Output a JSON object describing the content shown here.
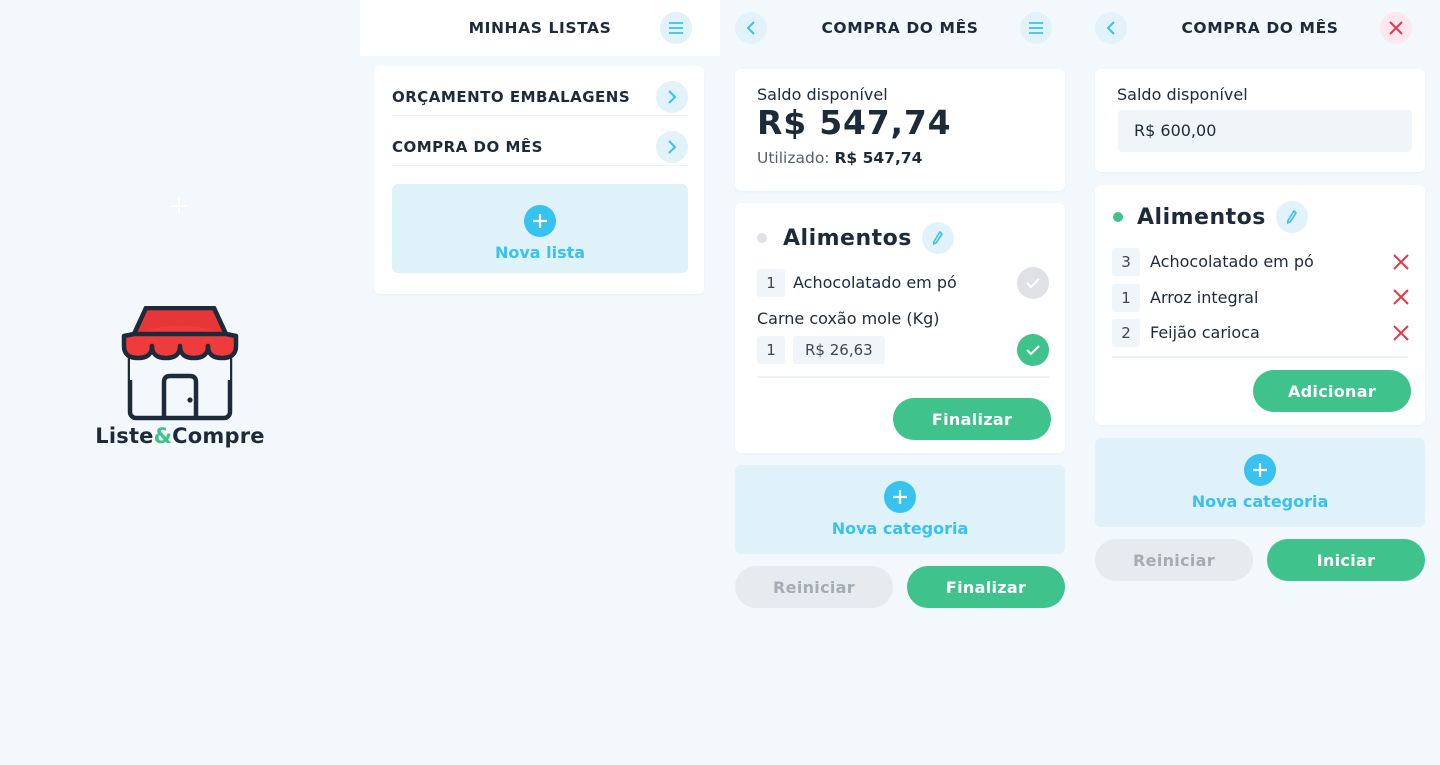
{
  "splash": {
    "brand_part1": "Liste",
    "brand_amp": "&",
    "brand_part2": "Compre",
    "awning_color": "#ef3b3b",
    "accent_color": "#3fc28c"
  },
  "lists_screen": {
    "title": "MINHAS LISTAS",
    "menu_icon": "hamburger-icon",
    "lists": [
      {
        "name": "ORÇAMENTO EMBALAGENS",
        "icon": "chevron-right-icon"
      },
      {
        "name": "COMPRA DO MÊS",
        "icon": "chevron-right-icon"
      }
    ],
    "new_list_label": "Nova lista"
  },
  "shopping_screen": {
    "title": "COMPRA DO MÊS",
    "back_icon": "chevron-left-icon",
    "menu_icon": "hamburger-icon",
    "balance_label": "Saldo disponível",
    "balance_value": "R$ 547,74",
    "used_label": "Utilizado:",
    "used_value": "R$ 547,74",
    "category": {
      "name": "Alimentos",
      "items": [
        {
          "qty": "1",
          "name": "Achocolatado em pó",
          "checked": false
        },
        {
          "qty": "1",
          "name": "Carne coxão mole (Kg)",
          "price": "R$ 26,63",
          "checked": true
        }
      ],
      "finish_label": "Finalizar"
    },
    "new_category_label": "Nova categoria",
    "reset_label": "Reiniciar",
    "finish_label": "Finalizar"
  },
  "edit_screen": {
    "title": "COMPRA DO MÊS",
    "back_icon": "chevron-left-icon",
    "close_icon": "close-icon",
    "balance_label": "Saldo disponível",
    "balance_input_value": "R$ 600,00",
    "category": {
      "name": "Alimentos",
      "items": [
        {
          "qty": "3",
          "name": "Achocolatado em pó"
        },
        {
          "qty": "1",
          "name": "Arroz integral"
        },
        {
          "qty": "2",
          "name": "Feijão carioca"
        }
      ],
      "add_label": "Adicionar"
    },
    "new_category_label": "Nova categoria",
    "reset_label": "Reiniciar",
    "start_label": "Iniciar"
  }
}
